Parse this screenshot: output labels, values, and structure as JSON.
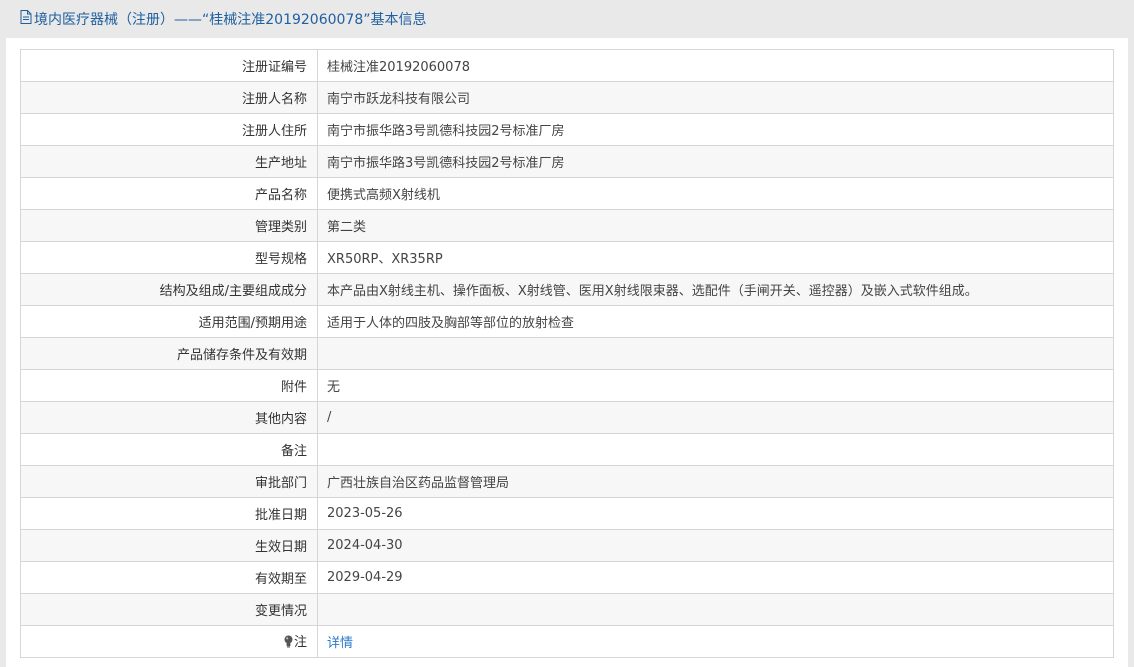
{
  "header": {
    "title": "境内医疗器械（注册）——“桂械注准20192060078”基本信息",
    "icon": "document-icon"
  },
  "rows": [
    {
      "label": "注册证编号",
      "value": "桂械注准20192060078"
    },
    {
      "label": "注册人名称",
      "value": "南宁市跃龙科技有限公司"
    },
    {
      "label": "注册人住所",
      "value": "南宁市振华路3号凯德科技园2号标准厂房"
    },
    {
      "label": "生产地址",
      "value": "南宁市振华路3号凯德科技园2号标准厂房"
    },
    {
      "label": "产品名称",
      "value": "便携式高频X射线机"
    },
    {
      "label": "管理类别",
      "value": "第二类"
    },
    {
      "label": "型号规格",
      "value": "XR50RP、XR35RP"
    },
    {
      "label": "结构及组成/主要组成成分",
      "value": "本产品由X射线主机、操作面板、X射线管、医用X射线限束器、选配件（手闸开关、遥控器）及嵌入式软件组成。"
    },
    {
      "label": "适用范围/预期用途",
      "value": "适用于人体的四肢及胸部等部位的放射检查"
    },
    {
      "label": "产品储存条件及有效期",
      "value": ""
    },
    {
      "label": "附件",
      "value": "无"
    },
    {
      "label": "其他内容",
      "value": "/"
    },
    {
      "label": "备注",
      "value": ""
    },
    {
      "label": "审批部门",
      "value": "广西壮族自治区药品监督管理局"
    },
    {
      "label": "批准日期",
      "value": "2023-05-26"
    },
    {
      "label": "生效日期",
      "value": "2024-04-30"
    },
    {
      "label": "有效期至",
      "value": "2029-04-29"
    },
    {
      "label": "变更情况",
      "value": ""
    }
  ],
  "note": {
    "label": "注",
    "icon": "lightbulb-icon",
    "link": "详情"
  },
  "colors": {
    "title": "#2060a0",
    "link": "#2a7acb",
    "border": "#d6d6d6",
    "stripe": "#f7f7f7"
  }
}
